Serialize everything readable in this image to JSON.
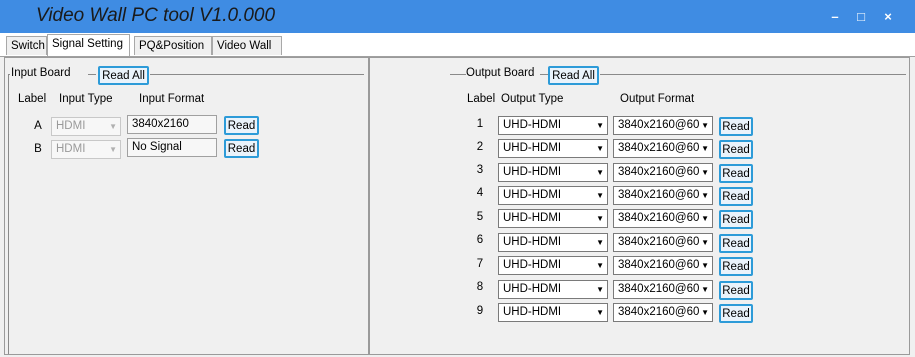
{
  "window": {
    "title": "Video Wall PC tool V1.0.000",
    "minimize": "–",
    "maximize": "□",
    "close": "×"
  },
  "tabs": [
    {
      "label": "Switch",
      "active": false
    },
    {
      "label": "Signal Setting",
      "active": true
    },
    {
      "label": "PQ&Position",
      "active": false
    },
    {
      "label": "Video Wall",
      "active": false
    }
  ],
  "input_board": {
    "group_label": "Input Board",
    "read_all": "Read All",
    "headers": {
      "label": "Label",
      "type": "Input Type",
      "format": "Input Format"
    },
    "rows": [
      {
        "label": "A",
        "type": "HDMI",
        "format": "3840x2160",
        "read": "Read"
      },
      {
        "label": "B",
        "type": "HDMI",
        "format": "No Signal",
        "read": "Read"
      }
    ]
  },
  "output_board": {
    "group_label": "Output Board",
    "read_all": "Read All",
    "headers": {
      "label": "Label",
      "type": "Output Type",
      "format": "Output Format"
    },
    "rows": [
      {
        "label": "1",
        "type": "UHD-HDMI",
        "format": "3840x2160@60",
        "read": "Read"
      },
      {
        "label": "2",
        "type": "UHD-HDMI",
        "format": "3840x2160@60",
        "read": "Read"
      },
      {
        "label": "3",
        "type": "UHD-HDMI",
        "format": "3840x2160@60",
        "read": "Read"
      },
      {
        "label": "4",
        "type": "UHD-HDMI",
        "format": "3840x2160@60",
        "read": "Read"
      },
      {
        "label": "5",
        "type": "UHD-HDMI",
        "format": "3840x2160@60",
        "read": "Read"
      },
      {
        "label": "6",
        "type": "UHD-HDMI",
        "format": "3840x2160@60",
        "read": "Read"
      },
      {
        "label": "7",
        "type": "UHD-HDMI",
        "format": "3840x2160@60",
        "read": "Read"
      },
      {
        "label": "8",
        "type": "UHD-HDMI",
        "format": "3840x2160@60",
        "read": "Read"
      },
      {
        "label": "9",
        "type": "UHD-HDMI",
        "format": "3840x2160@60",
        "read": "Read"
      }
    ]
  },
  "colors": {
    "titlebar": "#3f8ce3",
    "button_border": "#2d9bd8"
  }
}
